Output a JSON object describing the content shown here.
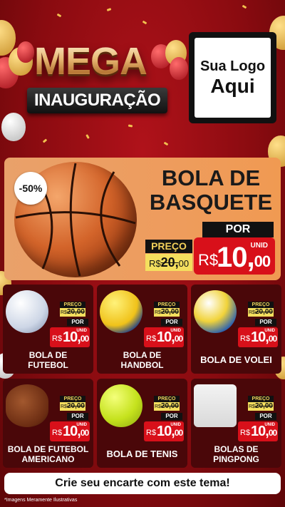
{
  "header": {
    "mega": "MEGA",
    "inauguracao": "INAUGURAÇÃO",
    "logo_line1": "Sua Logo",
    "logo_line2": "Aqui"
  },
  "hero": {
    "badge": "-50%",
    "title_line1": "BOLA DE",
    "title_line2": "BASQUETE",
    "por": "POR",
    "preco_label": "PREÇO",
    "old_currency": "R$",
    "old_value": "20,",
    "old_cents": "00",
    "unid": "UNID",
    "new_currency": "R$",
    "new_value": "10,",
    "new_cents": "00"
  },
  "products": [
    {
      "name_line1": "BOLA DE",
      "name_line2": "FUTEBOL",
      "preco": "PREÇO",
      "old": "20,00",
      "old_currency": "R$",
      "por": "POR",
      "unid": "UNID",
      "currency": "R$",
      "value": "10,",
      "cents": "00"
    },
    {
      "name_line1": "BOLA DE",
      "name_line2": "HANDBOL",
      "preco": "PREÇO",
      "old": "20,00",
      "old_currency": "R$",
      "por": "POR",
      "unid": "UNID",
      "currency": "R$",
      "value": "10,",
      "cents": "00"
    },
    {
      "name_line1": "BOLA DE VOLEI",
      "name_line2": "",
      "preco": "PREÇO",
      "old": "20,00",
      "old_currency": "R$",
      "por": "POR",
      "unid": "UNID",
      "currency": "R$",
      "value": "10,",
      "cents": "00"
    },
    {
      "name_line1": "BOLA DE FUTEBOL",
      "name_line2": "AMERICANO",
      "preco": "PREÇO",
      "old": "20,00",
      "old_currency": "R$",
      "por": "POR",
      "unid": "UNID",
      "currency": "R$",
      "value": "10,",
      "cents": "00"
    },
    {
      "name_line1": "BOLA DE TENIS",
      "name_line2": "",
      "preco": "PREÇO",
      "old": "20,00",
      "old_currency": "R$",
      "por": "POR",
      "unid": "UNID",
      "currency": "R$",
      "value": "10,",
      "cents": "00"
    },
    {
      "name_line1": "BOLAS DE",
      "name_line2": "PINGPONG",
      "preco": "PREÇO",
      "old": "20,00",
      "old_currency": "R$",
      "por": "POR",
      "unid": "UNID",
      "currency": "R$",
      "value": "10,",
      "cents": "00"
    }
  ],
  "footer": {
    "cta": "Crie seu encarte com este tema!",
    "disclaimer": "*Imagens Meramente Ilustrativas"
  },
  "colors": {
    "background": "#8a0b10",
    "price_red": "#d8101a",
    "old_price_yellow": "#f4df5e",
    "hero_orange": "#ee9c5d",
    "card_dark": "#4a0709"
  }
}
